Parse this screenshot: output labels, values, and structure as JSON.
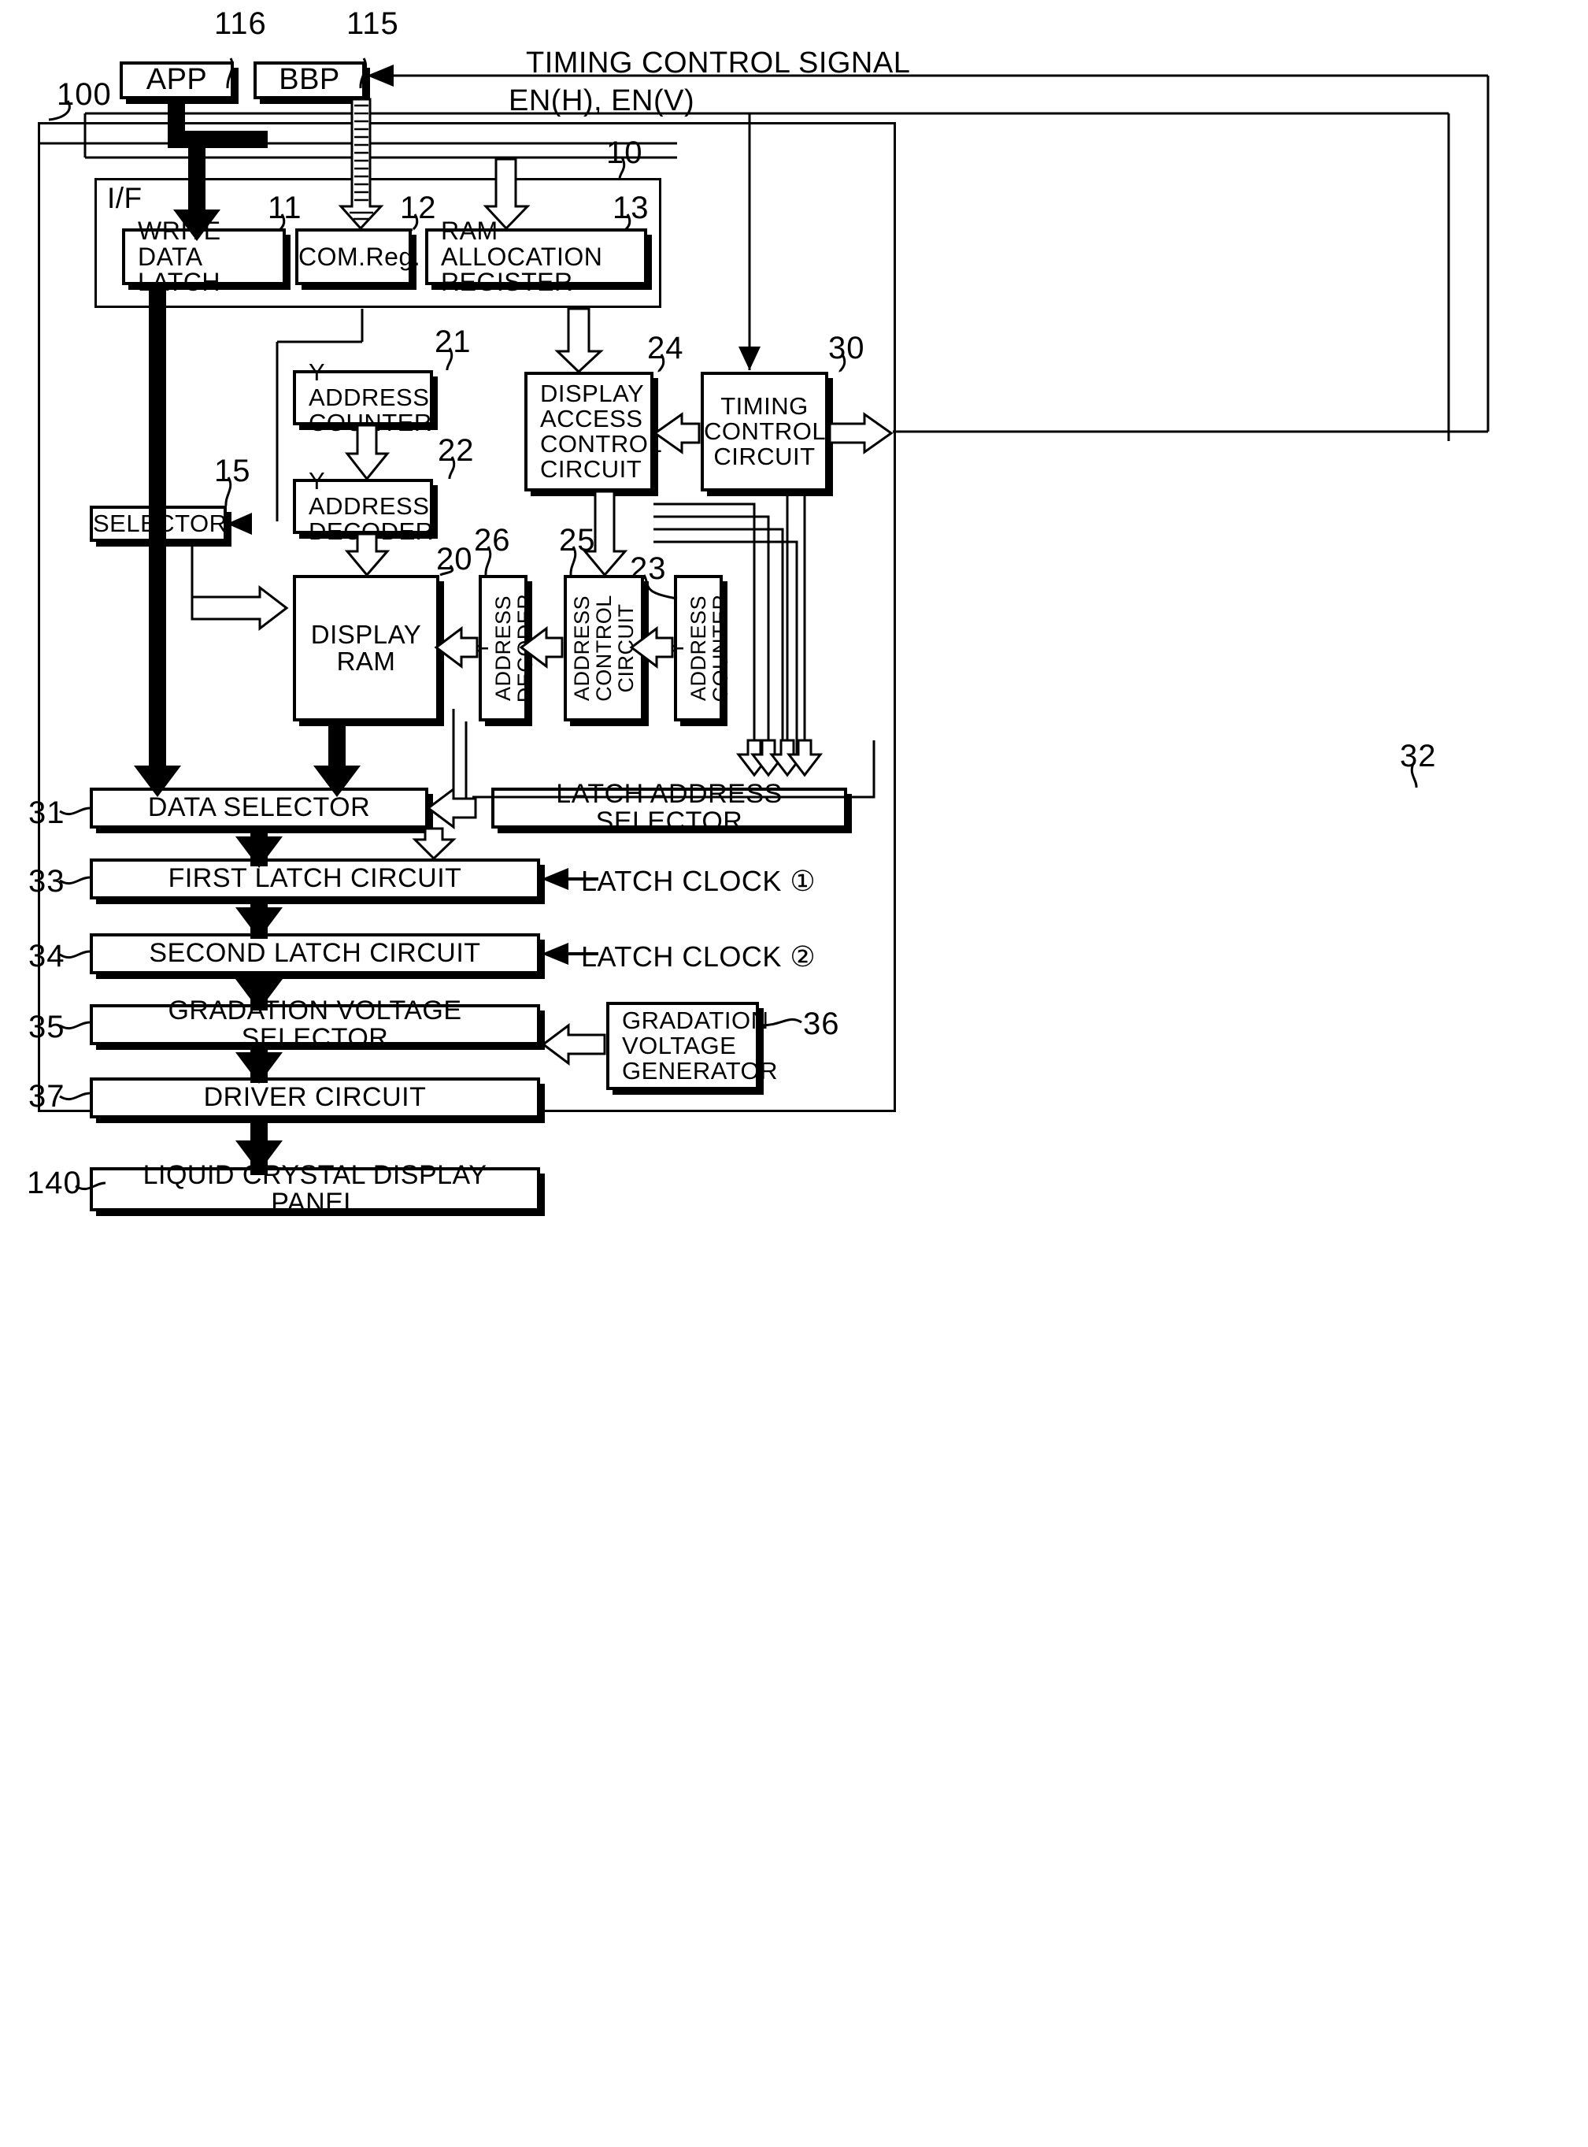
{
  "figure": {
    "outer_ref": "100",
    "panel_ref": "140"
  },
  "top": {
    "app": {
      "label": "APP",
      "ref": "116"
    },
    "bbp": {
      "label": "BBP",
      "ref": "115"
    },
    "timing_signal_line1": "TIMING CONTROL SIGNAL",
    "timing_signal_line2": "EN(H), EN(V)"
  },
  "interface": {
    "label": "I/F",
    "ref": "10",
    "blocks": [
      {
        "label": "WRITE DATA\nLATCH",
        "ref": "11"
      },
      {
        "label": "COM.Reg.",
        "ref": "12"
      },
      {
        "label": "RAM ALLOCATION\nREGISTER",
        "ref": "13"
      }
    ]
  },
  "core": {
    "y_address_counter_top": {
      "label": "Y ADDRESS\nCOUNTER",
      "ref": "21"
    },
    "y_address_decoder_top": {
      "label": "Y ADDRESS\nDECODER",
      "ref": "22"
    },
    "selector": {
      "label": "SELECTOR",
      "ref": "15"
    },
    "display_ram": {
      "label": "DISPLAY\nRAM",
      "ref": "20"
    },
    "display_access_control": {
      "label": "DISPLAY\nACCESS\nCONTROL\nCIRCUIT",
      "ref": "24"
    },
    "timing_control": {
      "label": "TIMING\nCONTROL\nCIRCUIT",
      "ref": "30"
    },
    "y_address_decoder_v": {
      "label": "Y ADDRESS\nDECODER",
      "ref": "26"
    },
    "address_control_v": {
      "label": "ADDRESS\nCONTROL\nCIRCUIT",
      "ref": "25"
    },
    "y_address_counter_v": {
      "label": "Y ADDRESS\nCOUNTER",
      "ref": "23"
    }
  },
  "chain": {
    "data_selector": {
      "label": "DATA SELECTOR",
      "ref": "31"
    },
    "latch_address_selector": {
      "label": "LATCH ADDRESS SELECTOR",
      "ref": "32"
    },
    "first_latch": {
      "label": "FIRST LATCH CIRCUIT",
      "ref": "33",
      "clock": "LATCH CLOCK ①"
    },
    "second_latch": {
      "label": "SECOND LATCH CIRCUIT",
      "ref": "34",
      "clock": "LATCH CLOCK ②"
    },
    "gradation_selector": {
      "label": "GRADATION VOLTAGE SELECTOR",
      "ref": "35"
    },
    "gradation_generator": {
      "label": "GRADATION\nVOLTAGE\nGENERATOR",
      "ref": "36"
    },
    "driver_circuit": {
      "label": "DRIVER CIRCUIT",
      "ref": "37"
    },
    "lcd_panel": {
      "label": "LIQUID CRYSTAL DISPLAY PANEL",
      "ref": "140"
    }
  }
}
